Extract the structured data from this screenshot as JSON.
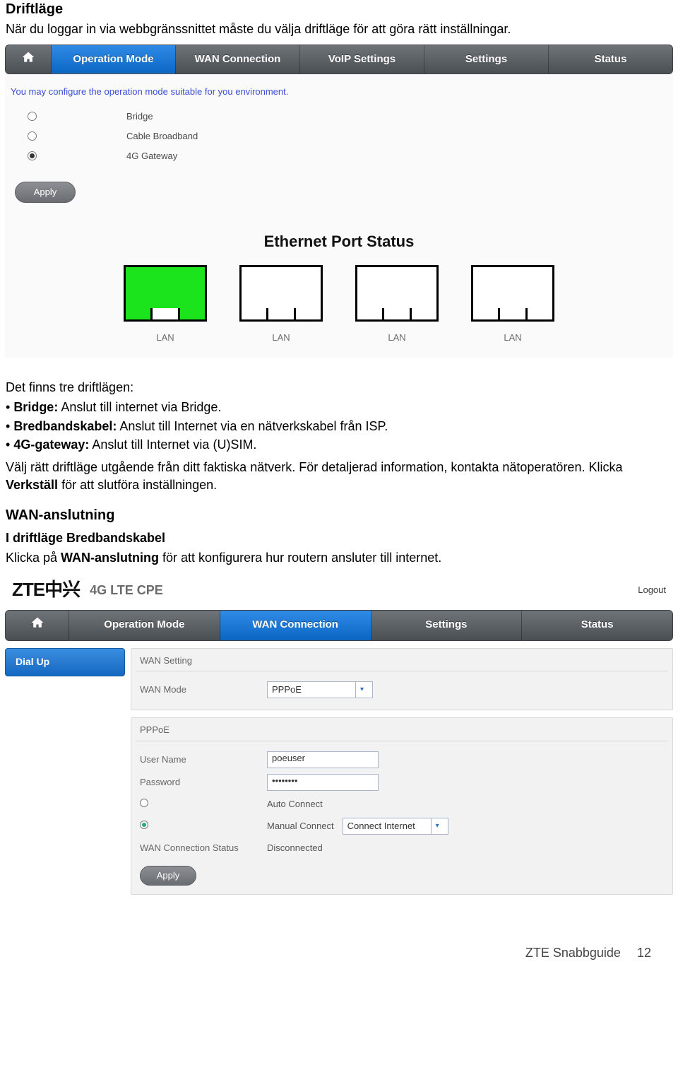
{
  "doc": {
    "heading1": "Driftläge",
    "intro1": "När du loggar in via webbgränssnittet måste du välja driftläge för att göra rätt inställningar.",
    "after_img_intro": "Det finns tre driftlägen:",
    "bullets": [
      {
        "b": "Bridge:",
        "t": " Anslut till internet via Bridge."
      },
      {
        "b": "Bredbandskabel:",
        "t": " Anslut till Internet via en nätverkskabel från ISP."
      },
      {
        "b": "4G-gateway:",
        "t": " Anslut till Internet via (U)SIM."
      }
    ],
    "para2a": "Välj rätt driftläge utgående från ditt faktiska nätverk. För detaljerad information, kontakta nätoperatören. Klicka ",
    "para2b": "Verkställ",
    "para2c": " för att slutföra inställningen.",
    "heading2": "WAN-anslutning",
    "heading3": "I driftläge Bredbandskabel",
    "para3a": "Klicka på ",
    "para3b": "WAN-anslutning",
    "para3c": " för att konfigurera hur routern ansluter till internet."
  },
  "ss1": {
    "tabs": [
      "Operation Mode",
      "WAN Connection",
      "VoIP Settings",
      "Settings",
      "Status"
    ],
    "helpText": "You may configure the operation mode suitable for you environment.",
    "options": [
      {
        "label": "Bridge",
        "selected": false
      },
      {
        "label": "Cable Broadband",
        "selected": false
      },
      {
        "label": "4G Gateway",
        "selected": true
      }
    ],
    "applyLabel": "Apply",
    "epsTitle": "Ethernet Port Status",
    "portLabel": "LAN"
  },
  "ss2": {
    "brand": "ZTE中兴",
    "brandSub": "4G LTE CPE",
    "logout": "Logout",
    "tabs": [
      "Operation Mode",
      "WAN Connection",
      "Settings",
      "Status"
    ],
    "sideTab": "Dial Up",
    "panel1": {
      "title": "WAN Setting",
      "wanModeLabel": "WAN Mode",
      "wanModeValue": "PPPoE"
    },
    "panel2": {
      "title": "PPPoE",
      "userLabel": "User Name",
      "userValue": "poeuser",
      "passLabel": "Password",
      "passValue": "••••••••",
      "autoLabel": "Auto Connect",
      "manualLabel": "Manual Connect",
      "manualSelect": "Connect Internet",
      "statusLabel": "WAN Connection Status",
      "statusValue": "Disconnected"
    },
    "applyLabel": "Apply"
  },
  "footer": {
    "text": "ZTE Snabbguide",
    "page": "12"
  }
}
